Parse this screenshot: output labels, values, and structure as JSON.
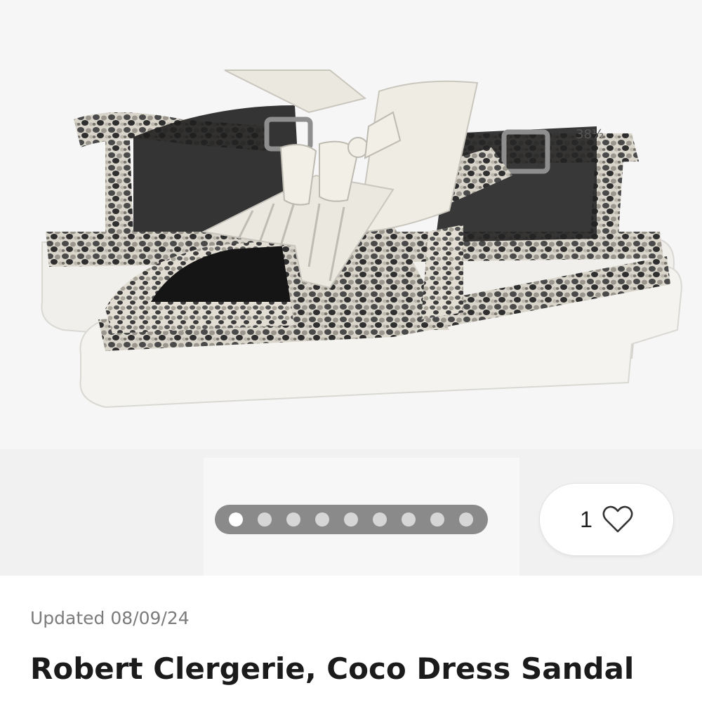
{
  "gallery": {
    "image_alt": "Robert Clergerie Coco Dress Sandal, snakeskin print with white sole",
    "page_count": 9,
    "active_index": 0
  },
  "like": {
    "count": "1",
    "icon": "heart-icon"
  },
  "listing": {
    "updated": "Updated 08/09/24",
    "title": "Robert Clergerie, Coco Dress Sandal"
  },
  "colors": {
    "text_primary": "#1b1b1b",
    "text_secondary": "#7b7b7b",
    "pager_track": "#8a8a8a",
    "pager_active": "#ffffff",
    "pager_inactive": "#d6d6d6"
  }
}
